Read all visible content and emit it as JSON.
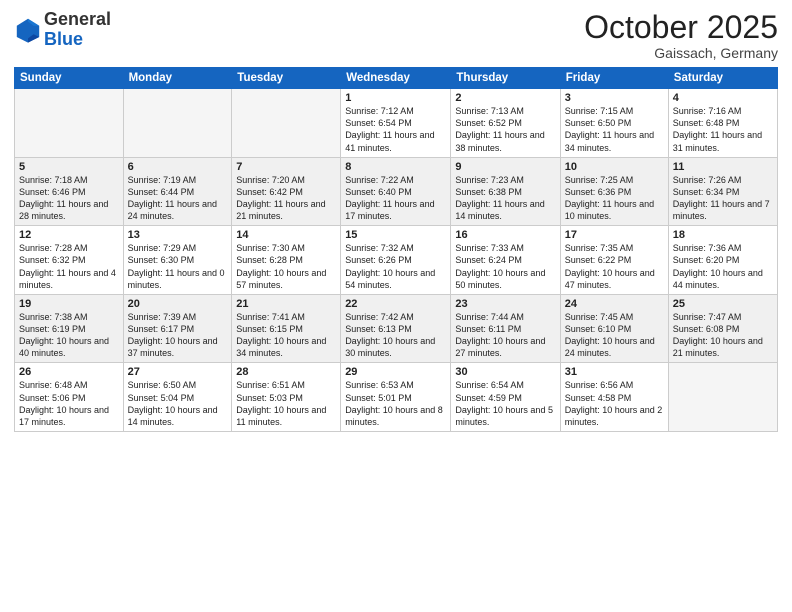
{
  "header": {
    "logo_general": "General",
    "logo_blue": "Blue",
    "month_title": "October 2025",
    "location": "Gaissach, Germany"
  },
  "weekdays": [
    "Sunday",
    "Monday",
    "Tuesday",
    "Wednesday",
    "Thursday",
    "Friday",
    "Saturday"
  ],
  "weeks": [
    [
      {
        "num": "",
        "info": ""
      },
      {
        "num": "",
        "info": ""
      },
      {
        "num": "",
        "info": ""
      },
      {
        "num": "1",
        "info": "Sunrise: 7:12 AM\nSunset: 6:54 PM\nDaylight: 11 hours and 41 minutes."
      },
      {
        "num": "2",
        "info": "Sunrise: 7:13 AM\nSunset: 6:52 PM\nDaylight: 11 hours and 38 minutes."
      },
      {
        "num": "3",
        "info": "Sunrise: 7:15 AM\nSunset: 6:50 PM\nDaylight: 11 hours and 34 minutes."
      },
      {
        "num": "4",
        "info": "Sunrise: 7:16 AM\nSunset: 6:48 PM\nDaylight: 11 hours and 31 minutes."
      }
    ],
    [
      {
        "num": "5",
        "info": "Sunrise: 7:18 AM\nSunset: 6:46 PM\nDaylight: 11 hours and 28 minutes."
      },
      {
        "num": "6",
        "info": "Sunrise: 7:19 AM\nSunset: 6:44 PM\nDaylight: 11 hours and 24 minutes."
      },
      {
        "num": "7",
        "info": "Sunrise: 7:20 AM\nSunset: 6:42 PM\nDaylight: 11 hours and 21 minutes."
      },
      {
        "num": "8",
        "info": "Sunrise: 7:22 AM\nSunset: 6:40 PM\nDaylight: 11 hours and 17 minutes."
      },
      {
        "num": "9",
        "info": "Sunrise: 7:23 AM\nSunset: 6:38 PM\nDaylight: 11 hours and 14 minutes."
      },
      {
        "num": "10",
        "info": "Sunrise: 7:25 AM\nSunset: 6:36 PM\nDaylight: 11 hours and 10 minutes."
      },
      {
        "num": "11",
        "info": "Sunrise: 7:26 AM\nSunset: 6:34 PM\nDaylight: 11 hours and 7 minutes."
      }
    ],
    [
      {
        "num": "12",
        "info": "Sunrise: 7:28 AM\nSunset: 6:32 PM\nDaylight: 11 hours and 4 minutes."
      },
      {
        "num": "13",
        "info": "Sunrise: 7:29 AM\nSunset: 6:30 PM\nDaylight: 11 hours and 0 minutes."
      },
      {
        "num": "14",
        "info": "Sunrise: 7:30 AM\nSunset: 6:28 PM\nDaylight: 10 hours and 57 minutes."
      },
      {
        "num": "15",
        "info": "Sunrise: 7:32 AM\nSunset: 6:26 PM\nDaylight: 10 hours and 54 minutes."
      },
      {
        "num": "16",
        "info": "Sunrise: 7:33 AM\nSunset: 6:24 PM\nDaylight: 10 hours and 50 minutes."
      },
      {
        "num": "17",
        "info": "Sunrise: 7:35 AM\nSunset: 6:22 PM\nDaylight: 10 hours and 47 minutes."
      },
      {
        "num": "18",
        "info": "Sunrise: 7:36 AM\nSunset: 6:20 PM\nDaylight: 10 hours and 44 minutes."
      }
    ],
    [
      {
        "num": "19",
        "info": "Sunrise: 7:38 AM\nSunset: 6:19 PM\nDaylight: 10 hours and 40 minutes."
      },
      {
        "num": "20",
        "info": "Sunrise: 7:39 AM\nSunset: 6:17 PM\nDaylight: 10 hours and 37 minutes."
      },
      {
        "num": "21",
        "info": "Sunrise: 7:41 AM\nSunset: 6:15 PM\nDaylight: 10 hours and 34 minutes."
      },
      {
        "num": "22",
        "info": "Sunrise: 7:42 AM\nSunset: 6:13 PM\nDaylight: 10 hours and 30 minutes."
      },
      {
        "num": "23",
        "info": "Sunrise: 7:44 AM\nSunset: 6:11 PM\nDaylight: 10 hours and 27 minutes."
      },
      {
        "num": "24",
        "info": "Sunrise: 7:45 AM\nSunset: 6:10 PM\nDaylight: 10 hours and 24 minutes."
      },
      {
        "num": "25",
        "info": "Sunrise: 7:47 AM\nSunset: 6:08 PM\nDaylight: 10 hours and 21 minutes."
      }
    ],
    [
      {
        "num": "26",
        "info": "Sunrise: 6:48 AM\nSunset: 5:06 PM\nDaylight: 10 hours and 17 minutes."
      },
      {
        "num": "27",
        "info": "Sunrise: 6:50 AM\nSunset: 5:04 PM\nDaylight: 10 hours and 14 minutes."
      },
      {
        "num": "28",
        "info": "Sunrise: 6:51 AM\nSunset: 5:03 PM\nDaylight: 10 hours and 11 minutes."
      },
      {
        "num": "29",
        "info": "Sunrise: 6:53 AM\nSunset: 5:01 PM\nDaylight: 10 hours and 8 minutes."
      },
      {
        "num": "30",
        "info": "Sunrise: 6:54 AM\nSunset: 4:59 PM\nDaylight: 10 hours and 5 minutes."
      },
      {
        "num": "31",
        "info": "Sunrise: 6:56 AM\nSunset: 4:58 PM\nDaylight: 10 hours and 2 minutes."
      },
      {
        "num": "",
        "info": ""
      }
    ]
  ]
}
